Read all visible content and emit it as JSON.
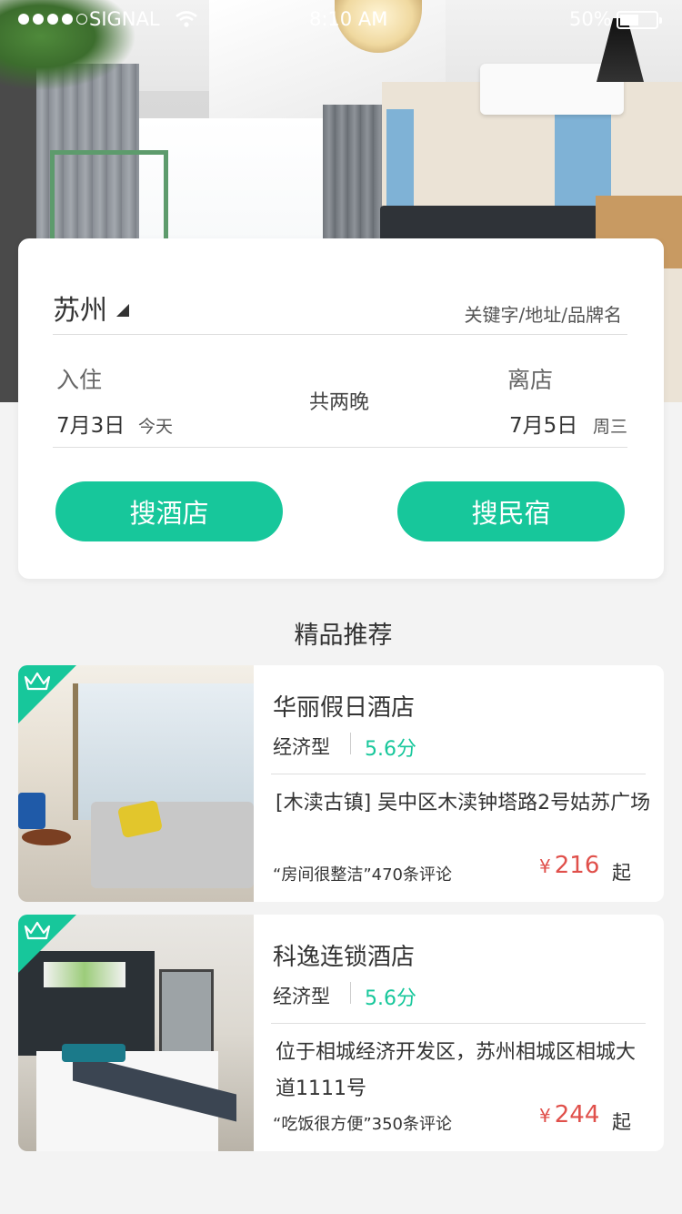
{
  "status_bar": {
    "carrier": "SIGNAL",
    "time": "8:10 AM",
    "battery": "50%",
    "battery_level": 0.5
  },
  "search": {
    "city": "苏州",
    "keyword_placeholder": "关键字/地址/品牌名",
    "checkin_label": "入住",
    "checkin_date": "7月3日",
    "checkin_day": "今天",
    "nights": "共两晚",
    "checkout_label": "离店",
    "checkout_date": "7月5日",
    "checkout_day": "周三",
    "hotel_button": "搜酒店",
    "bnb_button": "搜民宿"
  },
  "recommend": {
    "title": "精品推荐",
    "hotels": [
      {
        "name": "华丽假日酒店",
        "type": "经济型",
        "score": "5.6分",
        "address": "[木渎古镇] 吴中区木渎钟塔路2号姑苏广场",
        "review": "“房间很整洁”470条评论",
        "price_symbol": "¥",
        "price": "216",
        "price_suffix": "起"
      },
      {
        "name": "科逸连锁酒店",
        "type": "经济型",
        "score": "5.6分",
        "address": "位于相城经济开发区，苏州相城区相城大道1111号",
        "review": "“吃饭很方便”350条评论",
        "price_symbol": "¥",
        "price": "244",
        "price_suffix": "起"
      }
    ]
  },
  "colors": {
    "accent": "#17c79b",
    "price": "#e0504b",
    "background": "#f3f3f3"
  },
  "icons": [
    "wifi-icon",
    "battery-icon",
    "caret-icon",
    "crown-icon"
  ]
}
